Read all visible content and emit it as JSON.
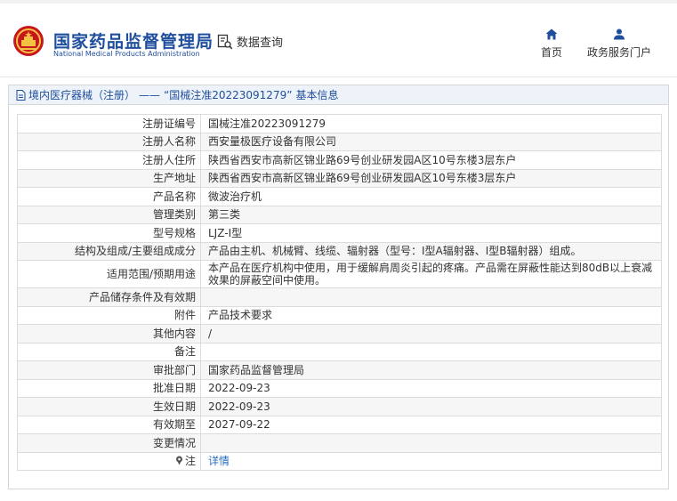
{
  "header": {
    "brand_cn": "国家药品监督管理局",
    "brand_en": "National Medical Products Administration",
    "data_query": "数据查询",
    "nav": [
      {
        "label": "首页",
        "icon": "home-icon"
      },
      {
        "label": "政务服务门户",
        "icon": "user-icon"
      }
    ]
  },
  "breadcrumb": {
    "section": "境内医疗器械（注册）",
    "dash": "——",
    "record": "“国械注准20223091279”",
    "suffix": "基本信息"
  },
  "fields": [
    {
      "label": "注册证编号",
      "value": "国械注准20223091279"
    },
    {
      "label": "注册人名称",
      "value": "西安量极医疗设备有限公司"
    },
    {
      "label": "注册人住所",
      "value": "陕西省西安市高新区锦业路69号创业研发园A区10号东楼3层东户"
    },
    {
      "label": "生产地址",
      "value": "陕西省西安市高新区锦业路69号创业研发园A区10号东楼3层东户"
    },
    {
      "label": "产品名称",
      "value": "微波治疗机"
    },
    {
      "label": "管理类别",
      "value": "第三类"
    },
    {
      "label": "型号规格",
      "value": "LJZ-Ⅰ型"
    },
    {
      "label": "结构及组成/主要组成成分",
      "value": "产品由主机、机械臂、线缆、辐射器（型号：Ⅰ型A辐射器、Ⅰ型B辐射器）组成。"
    },
    {
      "label": "适用范围/预期用途",
      "value": "本产品在医疗机构中使用，用于缓解肩周炎引起的疼痛。产品需在屏蔽性能达到80dB以上衰减效果的屏蔽空间中使用。"
    },
    {
      "label": "产品储存条件及有效期",
      "value": ""
    },
    {
      "label": "附件",
      "value": "产品技术要求"
    },
    {
      "label": "其他内容",
      "value": "/"
    },
    {
      "label": "备注",
      "value": ""
    },
    {
      "label": "审批部门",
      "value": "国家药品监督管理局"
    },
    {
      "label": "批准日期",
      "value": "2022-09-23"
    },
    {
      "label": "生效日期",
      "value": "2022-09-23"
    },
    {
      "label": "有效期至",
      "value": "2027-09-22"
    },
    {
      "label": "变更情况",
      "value": ""
    },
    {
      "label": "注",
      "value": "详情"
    }
  ],
  "colors": {
    "brand_blue": "#1f4e9c",
    "link_blue": "#2a6fc0",
    "row_alt": "#f6f6f6",
    "breadcrumb_bg": "#eef3f9"
  }
}
